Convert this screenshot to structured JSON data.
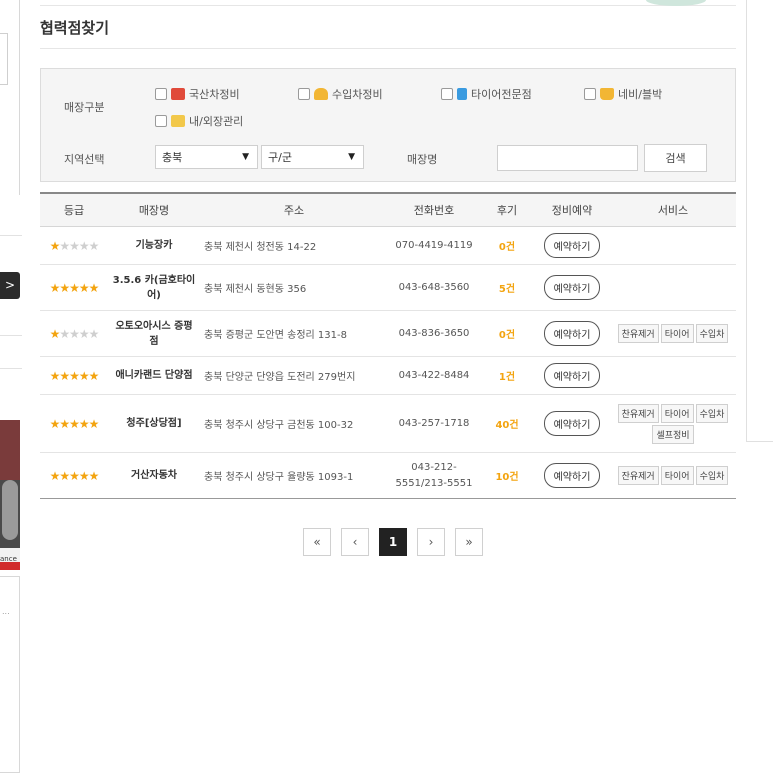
{
  "page_title": "협력점찾기",
  "filter": {
    "shop_type_label": "매장구분",
    "shop_types": [
      {
        "label": "국산차정비",
        "icon": "garage-icon",
        "color": "#e04a3a"
      },
      {
        "label": "수입차정비",
        "icon": "car-icon",
        "color": "#f2b634"
      },
      {
        "label": "타이어전문점",
        "icon": "tire-icon",
        "color": "#3a9be0"
      },
      {
        "label": "네비/블박",
        "icon": "crown-icon",
        "color": "#f2b634"
      },
      {
        "label": "내/외장관리",
        "icon": "wash-icon",
        "color": "#f2c84a"
      }
    ],
    "region_label": "지역선택",
    "region_value": "충북",
    "district_value": "구/군",
    "shop_name_label": "매장명",
    "shop_name_value": "",
    "search_button": "검색"
  },
  "table": {
    "headers": [
      "등급",
      "매장명",
      "주소",
      "전화번호",
      "후기",
      "정비예약",
      "서비스"
    ],
    "reserve_label": "예약하기",
    "rows": [
      {
        "stars": 1,
        "name": "기능장카",
        "address": "충북 제천시 청전동 14-22",
        "phone": "070-4419-4119",
        "reviews": "0건",
        "services": []
      },
      {
        "stars": 5,
        "name": "3.5.6 카(금호타이어)",
        "address": "충북 제천시 동현동 356",
        "phone": "043-648-3560",
        "reviews": "5건",
        "services": []
      },
      {
        "stars": 1,
        "name": "오토오아시스 증평점",
        "address": "충북 증평군 도안면 송정리 131-8",
        "phone": "043-836-3650",
        "reviews": "0건",
        "services": [
          "찬유제거",
          "타이어",
          "수입차"
        ]
      },
      {
        "stars": 5,
        "name": "애니카랜드 단양점",
        "address": "충북 단양군 단양읍 도전리 279번지",
        "phone": "043-422-8484",
        "reviews": "1건",
        "services": []
      },
      {
        "stars": 5,
        "name": "청주[상당점]",
        "address": "충북 청주시 상당구 금천동 100-32",
        "phone": "043-257-1718",
        "reviews": "40건",
        "services": [
          "찬유제거",
          "타이어",
          "수입차",
          "셀프정비"
        ]
      },
      {
        "stars": 5,
        "name": "거산자동차",
        "address": "충북 청주시 상당구 율량동 1093-1",
        "phone": "043-212-5551/213-5551",
        "reviews": "10건",
        "services": [
          "잔유제거",
          "타이어",
          "수입차"
        ]
      }
    ]
  },
  "pagination": {
    "first": "«",
    "prev": "‹",
    "current": "1",
    "next": "›",
    "last": "»"
  },
  "sidebar_fragment": {
    "arrow": ">",
    "image_caption": "ance"
  }
}
